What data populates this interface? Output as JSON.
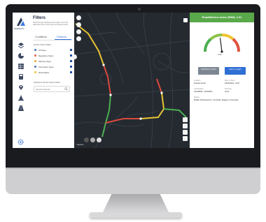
{
  "app": {
    "logo_text": "RoadMetrics"
  },
  "filters": {
    "title": "Filters",
    "description": "Filter through roadway information, from the data that best fit your app and requirements.",
    "tabs": [
      "Conditions",
      "Features"
    ],
    "active_tab": "Features",
    "road_features_heading": "ROAD FEATURES",
    "features": [
      {
        "label": "All Signs",
        "color": "#4a6fb5"
      },
      {
        "label": "Regulatory Signs",
        "color": "#e15b4a"
      },
      {
        "label": "Warning Signs",
        "color": "#f0a531"
      },
      {
        "label": "Information Signs",
        "color": "#4a6fb5"
      },
      {
        "label": "Road Marks",
        "color": "#f0c531"
      }
    ],
    "search_heading": "SEARCH ROAD FEATURES",
    "search_placeholder": "Search Features"
  },
  "map": {
    "attribution": "mapbox"
  },
  "panel": {
    "header": "RoadMetrics Index (RMI): 2.31",
    "gauge_value": "2.31",
    "gauge_fraction": 0.46,
    "buttons": {
      "left": "Subdivision Plans",
      "right": "Add to Length"
    },
    "info": [
      {
        "label": "Location",
        "value": "Dresden Road"
      },
      {
        "label": "Date of Scan",
        "value": "09/15/2022, 13:04"
      },
      {
        "label": "Coordinates",
        "value": "43.048595, -78.842811"
      },
      {
        "label": "Direction",
        "value": "North"
      },
      {
        "label": "Region",
        "value": "Buffalo (Northeastern), Cornwells, Niagara, Crossroads"
      }
    ],
    "accent": "#59a84a",
    "button_colors": {
      "left": "#7d8794",
      "right": "#2f6fd4"
    }
  }
}
